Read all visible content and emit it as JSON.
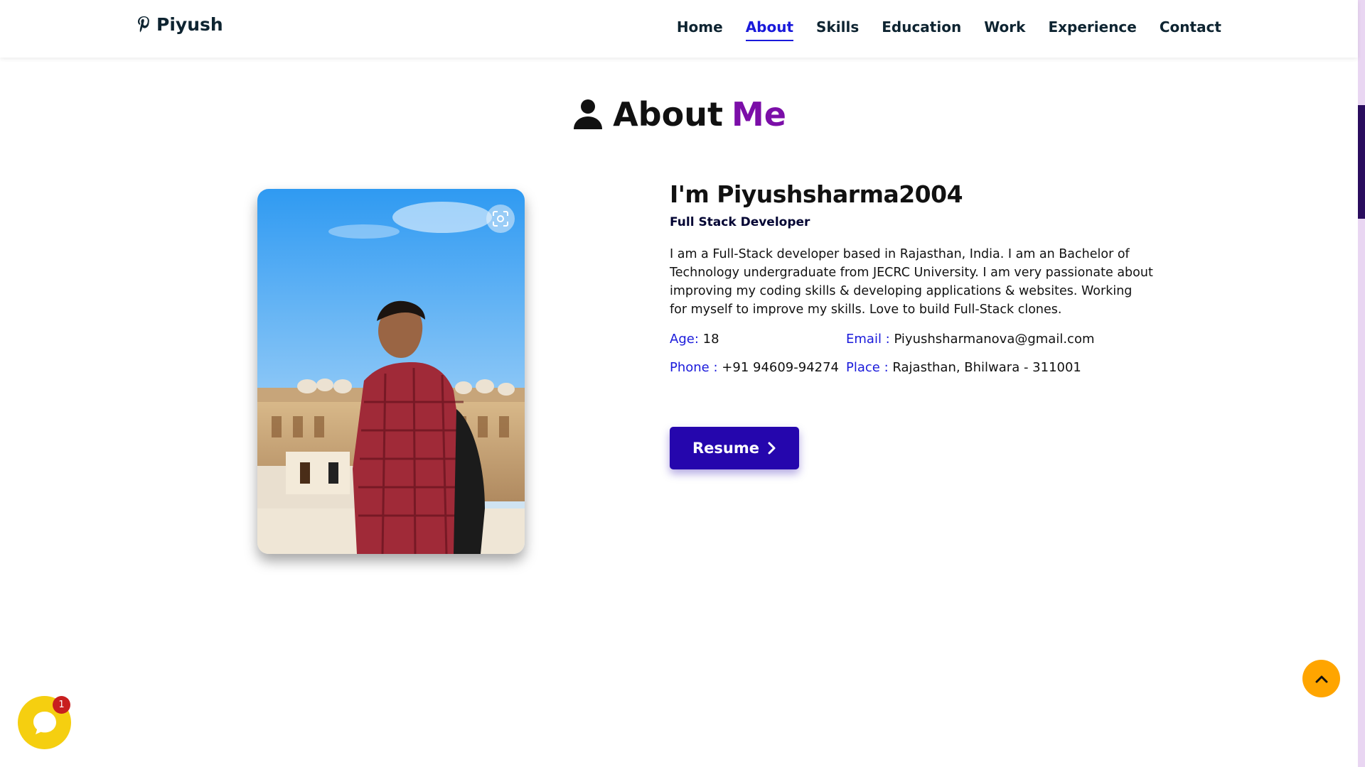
{
  "nav": {
    "logo_text": "Piyush",
    "logo_icon": "pinterest-p-icon",
    "links": [
      {
        "label": "Home",
        "active": false
      },
      {
        "label": "About",
        "active": true
      },
      {
        "label": "Skills",
        "active": false
      },
      {
        "label": "Education",
        "active": false
      },
      {
        "label": "Work",
        "active": false
      },
      {
        "label": "Experience",
        "active": false
      },
      {
        "label": "Contact",
        "active": false
      }
    ]
  },
  "about": {
    "heading_main": "About",
    "heading_accent": "Me",
    "heading_icon": "user-icon",
    "intro": "I'm Piyushsharma2004",
    "role": "Full Stack Developer",
    "bio": "I am a Full-Stack developer based in Rajasthan, India. I am an Bachelor of Technology undergraduate from JECRC University. I am very passionate about improving my coding skills & developing applications & websites. Working for myself to improve my skills. Love to build Full-Stack clones.",
    "info": {
      "age_label": "Age:",
      "age_value": "18",
      "email_label": "Email :",
      "email_value": "Piyushsharmanova@gmail.com",
      "phone_label": "Phone :",
      "phone_value": "+91 94609-94274",
      "place_label": "Place :",
      "place_value": "Rajasthan, Bhilwara - 311001"
    },
    "resume_label": "Resume"
  },
  "widgets": {
    "chat_badge": "1",
    "chat_icon": "chat-bubble-icon",
    "scroll_top_icon": "chevron-up-icon"
  },
  "colors": {
    "accent_purple": "#7b0ea8",
    "link_blue": "#1a1adb",
    "button_blue": "#2506ad",
    "chat_yellow": "#f5cf10",
    "scroll_orange": "#ffa500"
  }
}
